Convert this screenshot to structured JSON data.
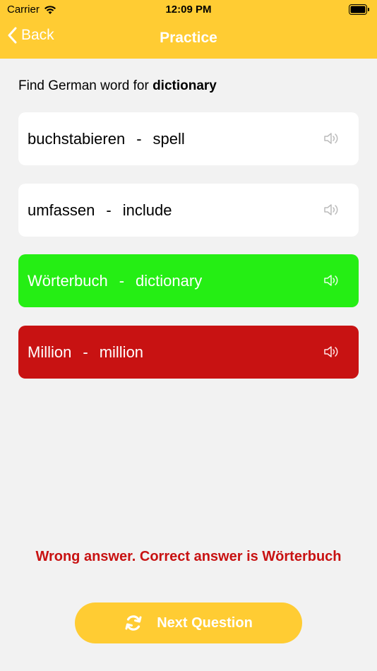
{
  "status": {
    "carrier": "Carrier",
    "time": "12:09 PM"
  },
  "nav": {
    "back_label": "Back",
    "title": "Practice"
  },
  "question": {
    "prefix": "Find German word for ",
    "word": "dictionary"
  },
  "options": [
    {
      "german": "buchstabieren",
      "separator": "-",
      "english": "spell",
      "state": "default"
    },
    {
      "german": "umfassen",
      "separator": "-",
      "english": "include",
      "state": "default"
    },
    {
      "german": "Wörterbuch",
      "separator": "-",
      "english": "dictionary",
      "state": "correct"
    },
    {
      "german": "Million",
      "separator": "-",
      "english": "million",
      "state": "wrong"
    }
  ],
  "feedback": "Wrong answer. Correct answer is Wörterbuch",
  "next_button": {
    "label": "Next Question",
    "icon": "refresh-icon"
  },
  "colors": {
    "accent": "#ffcc33",
    "correct": "#25ee14",
    "wrong": "#c81212",
    "background": "#f2f2f2"
  }
}
